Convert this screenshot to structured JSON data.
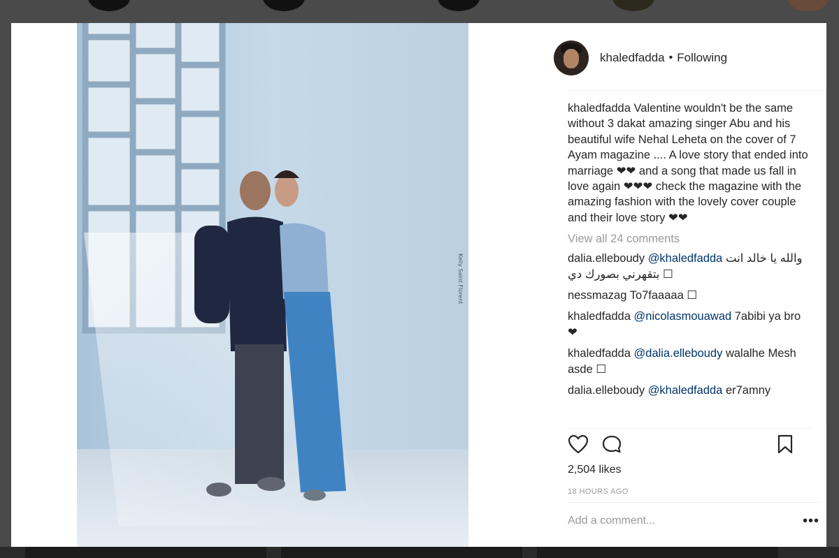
{
  "post": {
    "username": "khaledfadda",
    "separator": "•",
    "follow_status": "Following",
    "photo_credit": "Kelly Saint Florent",
    "caption_user": "khaledfadda",
    "caption_text": "Valentine wouldn't be the same without 3 dakat amazing singer Abu and his beautiful wife Nehal Leheta on the cover of 7 Ayam magazine .... A love story that ended into marriage ❤❤ and a song that made us fall in love again ❤❤❤ check the magazine with the amazing fashion with the lovely cover couple and their love story ❤❤",
    "view_all": "View all 24 comments",
    "comments": [
      {
        "user": "dalia.elleboudy",
        "mention": "@khaledfadda",
        "text": " والله يا خالد انت بتقهرني بصورك دي ☐"
      },
      {
        "user": "nessmazag",
        "mention": "",
        "text": "To7faaaaa ☐"
      },
      {
        "user": "khaledfadda",
        "mention": "@nicolasmouawad",
        "text": " 7abibi ya bro ❤"
      },
      {
        "user": "khaledfadda",
        "mention": "@dalia.elleboudy",
        "text": " walalhe Mesh asde ☐"
      },
      {
        "user": "dalia.elleboudy",
        "mention": "@khaledfadda",
        "text": " er7amny"
      }
    ],
    "likes": "2,504 likes",
    "time": "18 HOURS AGO",
    "add_comment_placeholder": "Add a comment...",
    "more_label": "•••"
  },
  "icons": {
    "like": "heart-icon",
    "comment": "comment-bubble-icon",
    "save": "bookmark-icon"
  },
  "colors": {
    "text": "#262626",
    "muted": "#999999",
    "mention": "#003569",
    "backdrop": "#4a4a4a"
  }
}
